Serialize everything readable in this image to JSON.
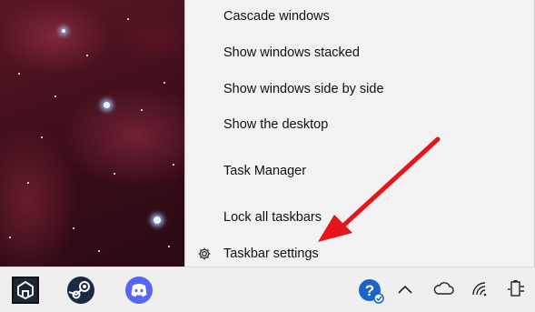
{
  "context_menu": {
    "items": [
      {
        "label": "Cascade windows"
      },
      {
        "label": "Show windows stacked"
      },
      {
        "label": "Show windows side by side"
      },
      {
        "label": "Show the desktop"
      },
      {
        "label": "Task Manager"
      },
      {
        "label": "Lock all taskbars"
      },
      {
        "label": "Taskbar settings",
        "icon": "gear-icon"
      }
    ]
  },
  "taskbar": {
    "pinned_apps": [
      {
        "icon": "app-launcher-icon"
      },
      {
        "icon": "steam-icon"
      },
      {
        "icon": "discord-icon"
      }
    ],
    "tray_icons": [
      "help-icon",
      "chevron-up-icon",
      "onedrive-cloud-icon",
      "wifi-icon",
      "battery-icon"
    ]
  },
  "annotation": {
    "type": "red-arrow",
    "color": "#e8141c",
    "points_to": "Taskbar settings"
  },
  "colors": {
    "menu_bg": "#f2f2f2",
    "taskbar_bg": "#f0efef",
    "arrow": "#e8141c",
    "discord": "#5865f2",
    "help": "#1a63c8"
  }
}
